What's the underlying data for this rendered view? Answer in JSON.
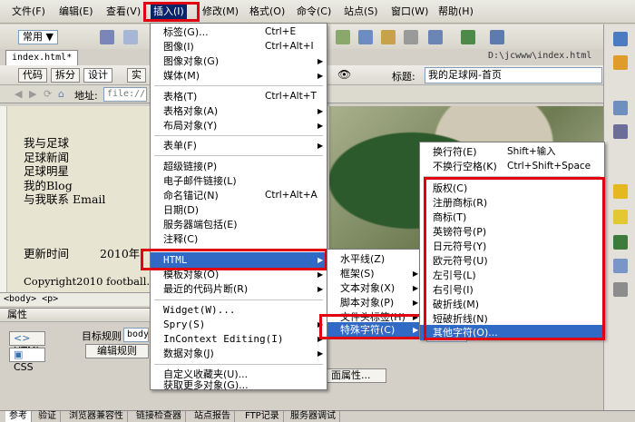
{
  "menubar": {
    "items": [
      "文件(F)",
      "编辑(E)",
      "查看(V)",
      "插入(I)",
      "修改(M)",
      "格式(O)",
      "命令(C)",
      "站点(S)",
      "窗口(W)",
      "帮助(H)"
    ]
  },
  "toolbar": {
    "category": "常用 ▼"
  },
  "document": {
    "tab": "index.html*",
    "path": "D:\\jcwww\\index.html",
    "view_buttons": [
      "代码",
      "拆分",
      "设计",
      "实"
    ],
    "title_label": "标题:",
    "title_value": "我的足球网-首页",
    "address_label": "地址:",
    "address_value": "file:///",
    "nav_links": [
      "我与足球",
      "足球新闻",
      "足球明星",
      "我的Blog",
      "与我联系 Email"
    ],
    "update_label": "更新时间",
    "update_year": "2010年",
    "copyright": "Copyright2010 football.com"
  },
  "tag_selector": "<body> <p>",
  "properties": {
    "header": "属性",
    "html_button": "HTML",
    "css_button": "CSS",
    "target_rule_label": "目标规则",
    "target_rule_value": "body",
    "edit_rule_button": "编辑规则",
    "page_props_button": "面属性..."
  },
  "bottom_tabs": [
    "参考",
    "验证",
    "浏览器兼容性",
    "链接检查器",
    "站点报告",
    "FTP记录",
    "服务器调试"
  ],
  "insert_menu": {
    "items": [
      {
        "label": "标签(G)...",
        "shortcut": "Ctrl+E",
        "submenu": false
      },
      {
        "label": "图像(I)",
        "shortcut": "Ctrl+Alt+I",
        "submenu": false
      },
      {
        "label": "图像对象(G)",
        "shortcut": "",
        "submenu": true
      },
      {
        "label": "媒体(M)",
        "shortcut": "",
        "submenu": true
      },
      {
        "label": "表格(T)",
        "shortcut": "Ctrl+Alt+T",
        "submenu": false
      },
      {
        "label": "表格对象(A)",
        "shortcut": "",
        "submenu": true
      },
      {
        "label": "布局对象(Y)",
        "shortcut": "",
        "submenu": true
      },
      {
        "label": "表单(F)",
        "shortcut": "",
        "submenu": true
      },
      {
        "label": "超级链接(P)",
        "shortcut": "",
        "submenu": false
      },
      {
        "label": "电子邮件链接(L)",
        "shortcut": "",
        "submenu": false
      },
      {
        "label": "命名锚记(N)",
        "shortcut": "Ctrl+Alt+A",
        "submenu": false
      },
      {
        "label": "日期(D)",
        "shortcut": "",
        "submenu": false
      },
      {
        "label": "服务器端包括(E)",
        "shortcut": "",
        "submenu": false
      },
      {
        "label": "注释(C)",
        "shortcut": "",
        "submenu": false
      },
      {
        "label": "HTML",
        "shortcut": "",
        "submenu": true
      },
      {
        "label": "模板对象(O)",
        "shortcut": "",
        "submenu": true
      },
      {
        "label": "最近的代码片断(R)",
        "shortcut": "",
        "submenu": true
      },
      {
        "label": "Widget(W)...",
        "shortcut": "",
        "submenu": false
      },
      {
        "label": "Spry(S)",
        "shortcut": "",
        "submenu": true
      },
      {
        "label": "InContext Editing(I)",
        "shortcut": "",
        "submenu": true
      },
      {
        "label": "数据对象(J)",
        "shortcut": "",
        "submenu": true
      },
      {
        "label": "自定义收藏夹(U)...",
        "shortcut": "",
        "submenu": false
      },
      {
        "label": "获取更多对象(G)...",
        "shortcut": "",
        "submenu": false
      }
    ]
  },
  "html_submenu": {
    "items": [
      {
        "label": "水平线(Z)",
        "submenu": false
      },
      {
        "label": "框架(S)",
        "submenu": true
      },
      {
        "label": "文本对象(X)",
        "submenu": true
      },
      {
        "label": "脚本对象(P)",
        "submenu": true
      },
      {
        "label": "文件头标签(H)",
        "submenu": true
      },
      {
        "label": "特殊字符(C)",
        "submenu": true
      }
    ]
  },
  "special_chars_menu": {
    "items": [
      {
        "label": "换行符(E)",
        "shortcut": "Shift+输入"
      },
      {
        "label": "不换行空格(K)",
        "shortcut": "Ctrl+Shift+Space"
      },
      {
        "label": "版权(C)",
        "shortcut": ""
      },
      {
        "label": "注册商标(R)",
        "shortcut": ""
      },
      {
        "label": "商标(T)",
        "shortcut": ""
      },
      {
        "label": "英镑符号(P)",
        "shortcut": ""
      },
      {
        "label": "日元符号(Y)",
        "shortcut": ""
      },
      {
        "label": "欧元符号(U)",
        "shortcut": ""
      },
      {
        "label": "左引号(L)",
        "shortcut": ""
      },
      {
        "label": "右引号(I)",
        "shortcut": ""
      },
      {
        "label": "破折线(M)",
        "shortcut": ""
      },
      {
        "label": "短破折线(N)",
        "shortcut": ""
      },
      {
        "label": "其他字符(O)...",
        "shortcut": ""
      }
    ]
  },
  "colors": {
    "highlight": "#316ac5",
    "annotation_red": "#e00010"
  }
}
